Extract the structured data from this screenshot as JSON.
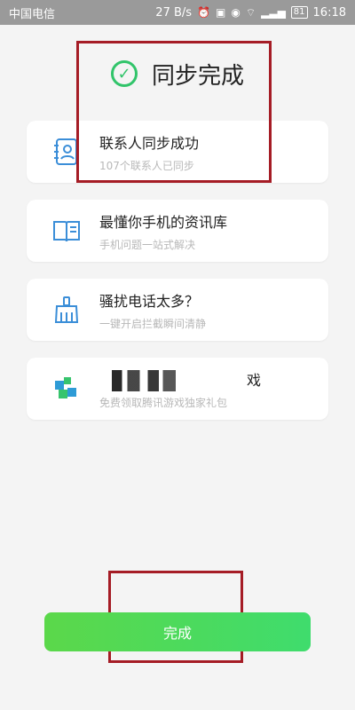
{
  "statusbar": {
    "carrier": "中国电信",
    "speed": "27 B/s",
    "battery": "81",
    "time": "16:18"
  },
  "header": {
    "title": "同步完成"
  },
  "cards": [
    {
      "title": "联系人同步成功",
      "subtitle": "107个联系人已同步",
      "icon": "contacts-book-icon"
    },
    {
      "title": "最懂你手机的资讯库",
      "subtitle": "手机问题一站式解决",
      "icon": "open-book-icon"
    },
    {
      "title": "骚扰电话太多？",
      "subtitle": "一键开启拦截瞬间清静",
      "icon": "broom-icon"
    },
    {
      "title": "戏",
      "subtitle": "免费领取腾讯游戏独家礼包",
      "icon": "tencent-games-icon"
    }
  ],
  "footer": {
    "done_label": "完成"
  },
  "colors": {
    "accent": "#31c46a",
    "highlight": "#a51c25"
  }
}
